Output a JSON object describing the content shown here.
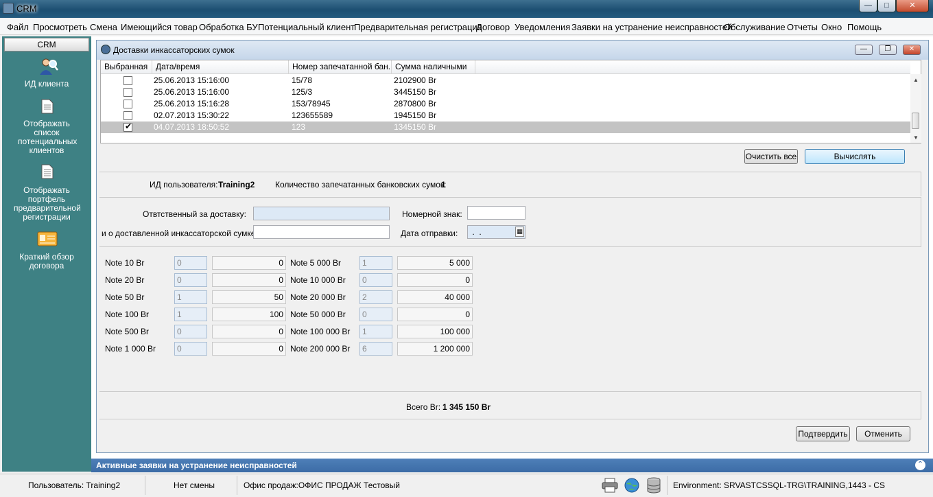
{
  "window": {
    "title": "CRM"
  },
  "menu": [
    "Файл",
    "Просмотреть",
    "Смена",
    "Имеющийся товар",
    "Обработка БУ",
    "Потенциальный клиент",
    "Предварительная регистрация",
    "Договор",
    "Уведомления",
    "Заявки на устранение неисправностей",
    "Обслуживание",
    "Отчеты",
    "Окно",
    "Помощь"
  ],
  "sidebar": {
    "header": "CRM",
    "items": [
      {
        "label": "ИД клиента",
        "icon": "user-search-icon"
      },
      {
        "label": "Отображать список потенциальных клиентов",
        "icon": "document-icon"
      },
      {
        "label": "Отображать портфель предварительной регистрации",
        "icon": "document-list-icon"
      },
      {
        "label": "Краткий обзор договора",
        "icon": "contract-card-icon"
      }
    ]
  },
  "child": {
    "title": "Доставки инкассаторских сумок"
  },
  "grid": {
    "headers": [
      "Выбранная",
      "Дата/время",
      "Номер запечатанной бан...",
      "Сумма наличными"
    ],
    "rows": [
      {
        "checked": false,
        "datetime": "25.06.2013 15:16:00",
        "number": "15/78",
        "amount": "2102900 Br"
      },
      {
        "checked": false,
        "datetime": "25.06.2013 15:16:00",
        "number": "125/3",
        "amount": "3445150 Br"
      },
      {
        "checked": false,
        "datetime": "25.06.2013 15:16:28",
        "number": "153/78945",
        "amount": "2870800 Br"
      },
      {
        "checked": false,
        "datetime": "02.07.2013 15:30:22",
        "number": "123655589",
        "amount": "1945150 Br"
      },
      {
        "checked": true,
        "datetime": "04.07.2013 18:50:52",
        "number": "123",
        "amount": "1345150 Br"
      }
    ]
  },
  "actions": {
    "clear_all": "Очистить все",
    "calculate": "Вычислять"
  },
  "info": {
    "user_label": "ИД пользователя:",
    "user_value": "Training2",
    "bags_label": "Количество запечатанных банковских сумок:",
    "bags_value": "1"
  },
  "form": {
    "responsible_label": "Отвтственный за доставку:",
    "responsible_value": "",
    "plate_label": "Номерной знак:",
    "plate_value": "",
    "note_label": "и о доставленной инкассаторской сумке:",
    "note_value": "",
    "date_label": "Дата отправки:",
    "date_value": " .  ."
  },
  "notes_left": [
    {
      "label": "Note 10 Br",
      "qty": "0",
      "sum": "0"
    },
    {
      "label": "Note 20 Br",
      "qty": "0",
      "sum": "0"
    },
    {
      "label": "Note 50 Br",
      "qty": "1",
      "sum": "50"
    },
    {
      "label": "Note 100 Br",
      "qty": "1",
      "sum": "100"
    },
    {
      "label": "Note 500 Br",
      "qty": "0",
      "sum": "0"
    },
    {
      "label": "Note 1 000 Br",
      "qty": "0",
      "sum": "0"
    }
  ],
  "notes_right": [
    {
      "label": "Note 5 000 Br",
      "qty": "1",
      "sum": "5 000"
    },
    {
      "label": "Note 10 000 Br",
      "qty": "0",
      "sum": "0"
    },
    {
      "label": "Note 20 000 Br",
      "qty": "2",
      "sum": "40 000"
    },
    {
      "label": "Note 50 000 Br",
      "qty": "0",
      "sum": "0"
    },
    {
      "label": "Note 100 000 Br",
      "qty": "1",
      "sum": "100 000"
    },
    {
      "label": "Note 200 000 Br",
      "qty": "6",
      "sum": "1 200 000"
    }
  ],
  "total": {
    "label": "Всего Br:",
    "value": "1 345 150 Br"
  },
  "footer_buttons": {
    "confirm": "Подтвердить",
    "cancel": "Отменить"
  },
  "bottom_panel": {
    "title": "Активные заявки на устранение неисправностей"
  },
  "status": {
    "user": "Пользователь: Training2",
    "shift": "Нет смены",
    "office": "Офис продаж:ОФИС ПРОДАЖ Тестовый",
    "environment": "Environment: SRVASTCSSQL-TRG\\TRAINING,1443 - CS"
  }
}
